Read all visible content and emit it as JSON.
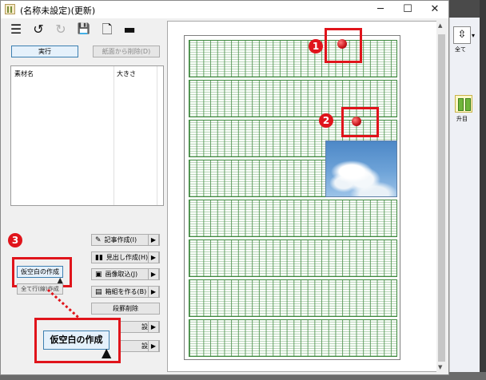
{
  "window": {
    "title": "(名称未設定)(更新)",
    "min": "─",
    "max": "☐",
    "close": "✕"
  },
  "toolbar": {
    "menu": "☰",
    "undo": "↺",
    "redo": "↻",
    "save": "💾",
    "new_page": "🗋",
    "open": "▬"
  },
  "execute_button": "実行",
  "remove_button": "紙面から削除(D)",
  "list": {
    "col_name": "素材名",
    "col_size": "大きさ"
  },
  "commands": [
    {
      "icon": "✎",
      "label": "記事作成(I)",
      "arrow": "▶"
    },
    {
      "icon": "▮▮",
      "label": "見出し作成(H)",
      "arrow": "▶"
    },
    {
      "icon": "▣",
      "label": "画像取込(J)",
      "arrow": "▶"
    },
    {
      "icon": "▤",
      "label": "箱組を作る(B)",
      "arrow": "▶"
    },
    {
      "label": "段罫削除"
    },
    {
      "label": "設定",
      "arrow": "▶"
    },
    {
      "label": "設定",
      "arrow": "▶"
    }
  ],
  "small_buttons": {
    "kuuhaku": "仮空白の作成",
    "second": "全て行(線)作成"
  },
  "callout": {
    "label": "仮空白の作成"
  },
  "badges": {
    "one": "1",
    "two": "2",
    "three": "3"
  },
  "side_panel": {
    "all_label": "全て",
    "vertical_label": "升目",
    "fit_icon": "⇳",
    "dropdown": "▾"
  },
  "colors": {
    "highlight": "#e0141b",
    "grid": "#3f8a3f"
  },
  "icons": {
    "cursor": "pointer-cursor-icon",
    "pin": "pushpin-icon"
  }
}
